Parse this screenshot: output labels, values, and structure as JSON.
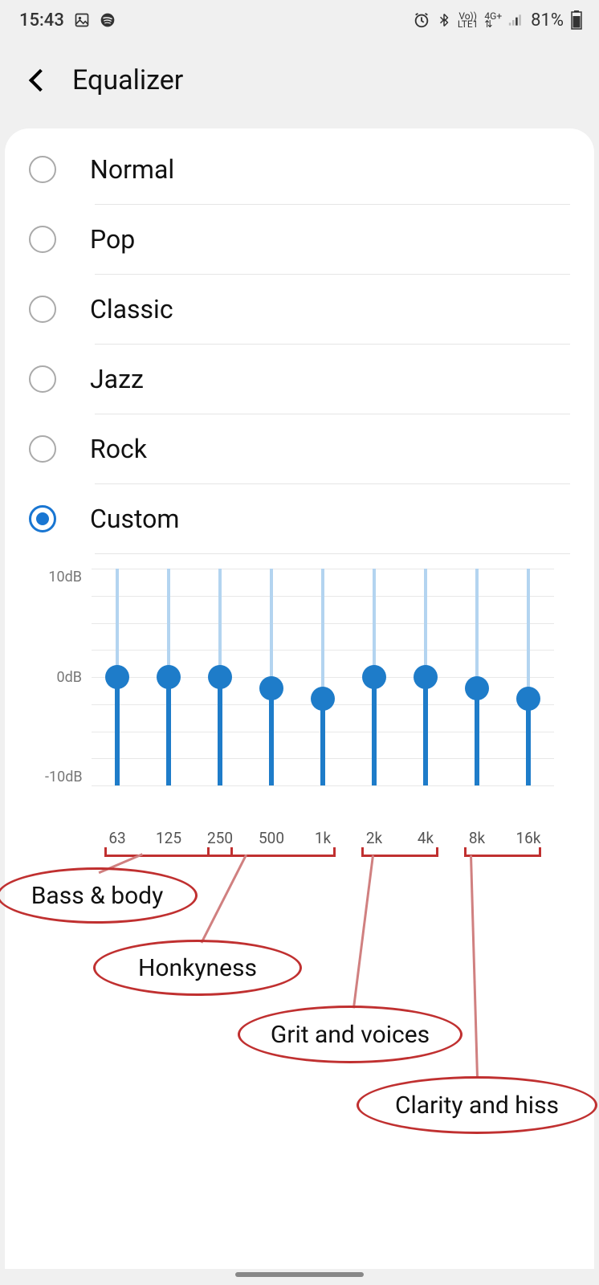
{
  "status_bar": {
    "time": "15:43",
    "battery_pct": "81%",
    "icons": {
      "gallery": "gallery-icon",
      "spotify": "spotify-icon",
      "alarm": "alarm-icon",
      "bluetooth": "bluetooth-icon",
      "volte": "Vo))\nLTE1",
      "network": "4G+",
      "signal": "signal-icon",
      "battery": "battery-icon"
    }
  },
  "header": {
    "title": "Equalizer"
  },
  "presets": [
    {
      "label": "Normal",
      "selected": false
    },
    {
      "label": "Pop",
      "selected": false
    },
    {
      "label": "Classic",
      "selected": false
    },
    {
      "label": "Jazz",
      "selected": false
    },
    {
      "label": "Rock",
      "selected": false
    },
    {
      "label": "Custom",
      "selected": true
    }
  ],
  "chart_data": {
    "type": "bar",
    "title": "",
    "xlabel": "",
    "ylabel": "",
    "ylim": [
      -10,
      10
    ],
    "y_ticks": [
      "10dB",
      "0dB",
      "-10dB"
    ],
    "categories": [
      "63",
      "125",
      "250",
      "500",
      "1k",
      "2k",
      "4k",
      "8k",
      "16k"
    ],
    "values": [
      0,
      0,
      0,
      -1,
      -2,
      0,
      0,
      -1,
      -2
    ]
  },
  "annotations": [
    {
      "label": "Bass & body",
      "range": [
        "63",
        "250"
      ]
    },
    {
      "label": "Honkyness",
      "range": [
        "250",
        "1k"
      ]
    },
    {
      "label": "Grit and voices",
      "range": [
        "2k",
        "4k"
      ]
    },
    {
      "label": "Clarity and hiss",
      "range": [
        "8k",
        "16k"
      ]
    }
  ],
  "annotation_color": "#c03030",
  "accent_color": "#1e7cc9"
}
